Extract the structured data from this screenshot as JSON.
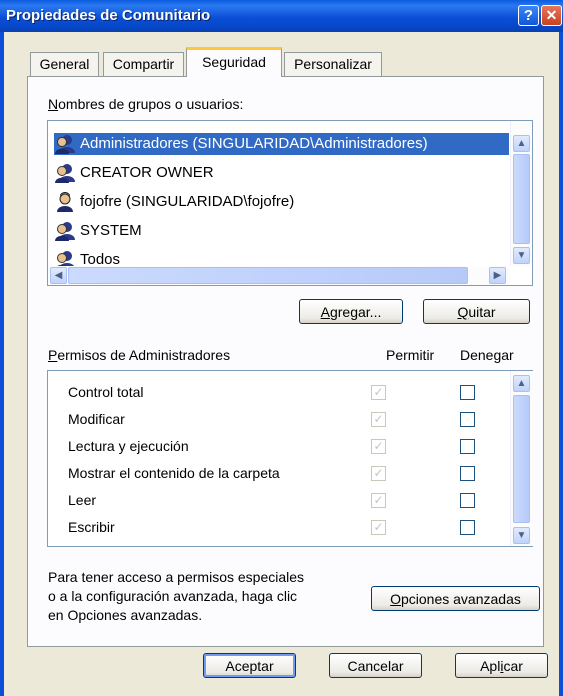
{
  "window": {
    "title": "Propiedades de Comunitario",
    "help_glyph": "?",
    "close_glyph": "✕"
  },
  "tabs": [
    {
      "label": "General"
    },
    {
      "label": "Compartir"
    },
    {
      "label": "Seguridad",
      "active": true
    },
    {
      "label": "Personalizar"
    }
  ],
  "groups": {
    "label": "Nombres de grupos o usuarios:",
    "users": [
      {
        "name": "Administradores (SINGULARIDAD\\Administradores)",
        "selected": true,
        "icon": "group-icon"
      },
      {
        "name": "CREATOR OWNER",
        "icon": "group-icon"
      },
      {
        "name": "fojofre (SINGULARIDAD\\fojofre)",
        "icon": "user-icon"
      },
      {
        "name": "SYSTEM",
        "icon": "group-icon"
      },
      {
        "name": "Todos",
        "icon": "group-icon"
      }
    ],
    "add_button": "Agregar...",
    "remove_button": "Quitar"
  },
  "permissions": {
    "label": "Permisos de Administradores",
    "allow_header": "Permitir",
    "deny_header": "Denegar",
    "items": [
      {
        "name": "Control total",
        "allow": true,
        "deny": false
      },
      {
        "name": "Modificar",
        "allow": true,
        "deny": false
      },
      {
        "name": "Lectura y ejecución",
        "allow": true,
        "deny": false
      },
      {
        "name": "Mostrar el contenido de la carpeta",
        "allow": true,
        "deny": false
      },
      {
        "name": "Leer",
        "allow": true,
        "deny": false
      },
      {
        "name": "Escribir",
        "allow": true,
        "deny": false
      }
    ]
  },
  "advanced": {
    "text_lines": [
      "Para tener acceso a permisos especiales",
      "o a la configuración avanzada, haga clic",
      "en Opciones avanzadas."
    ],
    "button": "Opciones avanzadas"
  },
  "footer": {
    "ok": "Aceptar",
    "cancel": "Cancelar",
    "apply": "Aplicar"
  },
  "colors": {
    "selection": "#316ac5",
    "titlebar": "#0b4fd8",
    "tab_highlight": "#ffc83c"
  }
}
